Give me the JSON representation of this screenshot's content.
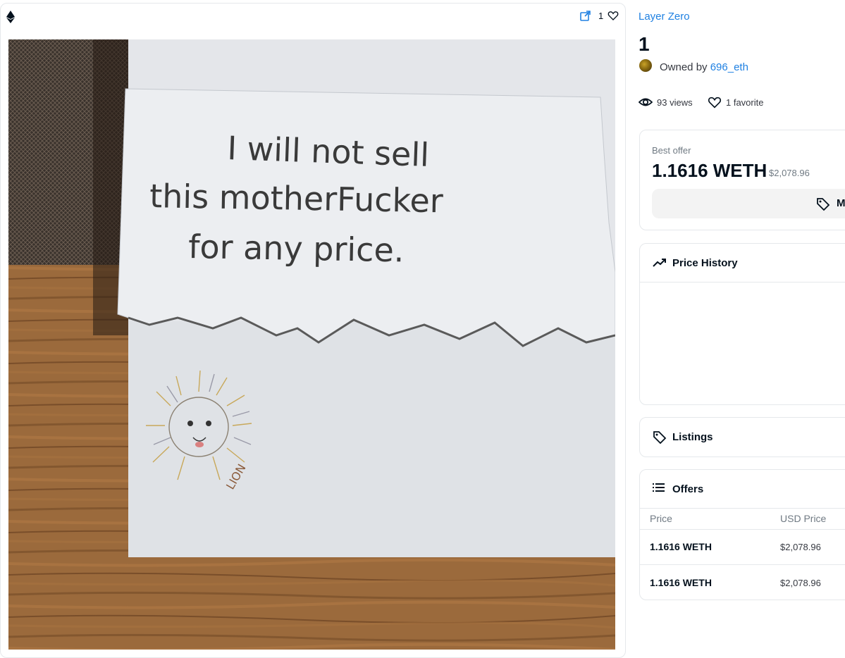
{
  "media": {
    "favorite_count": "1",
    "artwork_text": [
      "I will not sell",
      "this motherFucker",
      "for any price."
    ],
    "artwork_signature": "LION"
  },
  "collection_name": "Layer Zero",
  "token_name": "1",
  "owner": {
    "prefix": "Owned by",
    "name": "696_eth"
  },
  "stats": {
    "views": "93 views",
    "favorites": "1 favorite"
  },
  "best_offer": {
    "label": "Best offer",
    "amount": "1.1616 WETH",
    "usd": "$2,078.96",
    "button_label": "M"
  },
  "price_history": {
    "title": "Price History"
  },
  "listings": {
    "title": "Listings"
  },
  "offers": {
    "title": "Offers",
    "columns": [
      "Price",
      "USD Price"
    ],
    "rows": [
      {
        "price": "1.1616 WETH",
        "usd": "$2,078.96"
      },
      {
        "price": "1.1616 WETH",
        "usd": "$2,078.96"
      }
    ]
  },
  "colors": {
    "link": "#2081e2",
    "border": "#e5e8eb",
    "muted": "#707a83",
    "text": "#04111d"
  }
}
